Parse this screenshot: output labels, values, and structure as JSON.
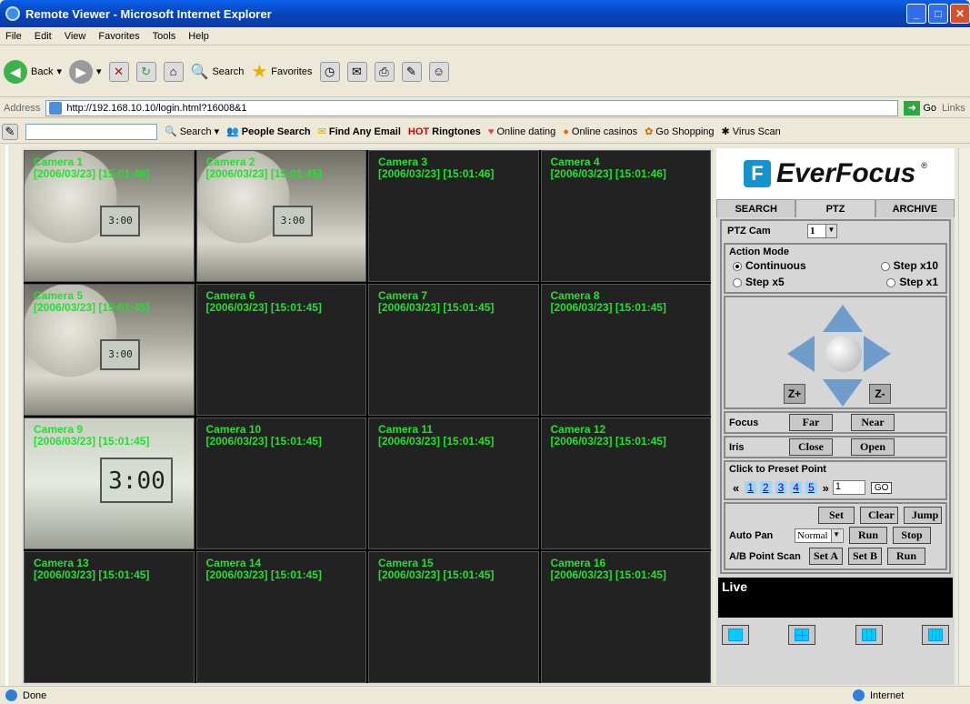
{
  "window": {
    "title": "Remote Viewer - Microsoft Internet Explorer"
  },
  "menu": [
    "File",
    "Edit",
    "View",
    "Favorites",
    "Tools",
    "Help"
  ],
  "toolbar": {
    "back": "Back",
    "search": "Search",
    "favorites": "Favorites"
  },
  "address": {
    "label": "Address",
    "url": "http://192.168.10.10/login.html?16008&1",
    "go": "Go",
    "links": "Links"
  },
  "linksbar": {
    "search": "Search",
    "people": "People Search",
    "email": "Find Any Email",
    "hot": "HOT",
    "ringtones": "Ringtones",
    "dating": "Online dating",
    "casinos": "Online casinos",
    "shopping": "Go Shopping",
    "virus": "Virus Scan"
  },
  "cameras": [
    {
      "name": "Camera 1",
      "time": "[2006/03/23] [15:01:46]",
      "feed": "room"
    },
    {
      "name": "Camera 2",
      "time": "[2006/03/23] [15:01:45]",
      "feed": "room"
    },
    {
      "name": "Camera 3",
      "time": "[2006/03/23] [15:01:46]",
      "feed": "none"
    },
    {
      "name": "Camera 4",
      "time": "[2006/03/23] [15:01:46]",
      "feed": "none"
    },
    {
      "name": "Camera 5",
      "time": "[2006/03/23] [15:01:45]",
      "feed": "room"
    },
    {
      "name": "Camera 6",
      "time": "[2006/03/23] [15:01:45]",
      "feed": "none"
    },
    {
      "name": "Camera 7",
      "time": "[2006/03/23] [15:01:45]",
      "feed": "none"
    },
    {
      "name": "Camera 8",
      "time": "[2006/03/23] [15:01:45]",
      "feed": "none"
    },
    {
      "name": "Camera 9",
      "time": "[2006/03/23] [15:01:45]",
      "feed": "closeup"
    },
    {
      "name": "Camera 10",
      "time": "[2006/03/23] [15:01:45]",
      "feed": "none"
    },
    {
      "name": "Camera 11",
      "time": "[2006/03/23] [15:01:45]",
      "feed": "none"
    },
    {
      "name": "Camera 12",
      "time": "[2006/03/23] [15:01:45]",
      "feed": "none"
    },
    {
      "name": "Camera 13",
      "time": "[2006/03/23] [15:01:45]",
      "feed": "none"
    },
    {
      "name": "Camera 14",
      "time": "[2006/03/23] [15:01:45]",
      "feed": "none"
    },
    {
      "name": "Camera 15",
      "time": "[2006/03/23] [15:01:45]",
      "feed": "none"
    },
    {
      "name": "Camera 16",
      "time": "[2006/03/23] [15:01:45]",
      "feed": "none"
    }
  ],
  "feed_text": {
    "clock_small": "3:00",
    "clock_large": "3:00"
  },
  "panel": {
    "brand": "EverFocus",
    "brand_mark": "F",
    "tabs": [
      "SEARCH",
      "PTZ",
      "ARCHIVE"
    ],
    "ptz_cam_label": "PTZ Cam",
    "ptz_cam_value": "1",
    "action_mode_label": "Action Mode",
    "modes": [
      "Continuous",
      "Step x10",
      "Step x5",
      "Step x1"
    ],
    "zoom_in": "Z+",
    "zoom_out": "Z-",
    "focus_label": "Focus",
    "far": "Far",
    "near": "Near",
    "iris_label": "Iris",
    "close": "Close",
    "open": "Open",
    "preset_label": "Click to Preset Point",
    "prev": "«",
    "next": "»",
    "presets": [
      "1",
      "2",
      "3",
      "4",
      "5"
    ],
    "preset_value": "1",
    "go": "GO",
    "set": "Set",
    "clear": "Clear",
    "jump": "Jump",
    "auto_pan_label": "Auto Pan",
    "auto_pan_value": "Normal",
    "run": "Run",
    "stop": "Stop",
    "ab_label": "A/B Point Scan",
    "set_a": "Set A",
    "set_b": "Set B",
    "live": "Live"
  },
  "status": {
    "text": "Done",
    "zone": "Internet"
  },
  "colors": {
    "camera_label": "#22e030",
    "titlebar": "#0842b8",
    "brand_blue": "#1493ce"
  }
}
